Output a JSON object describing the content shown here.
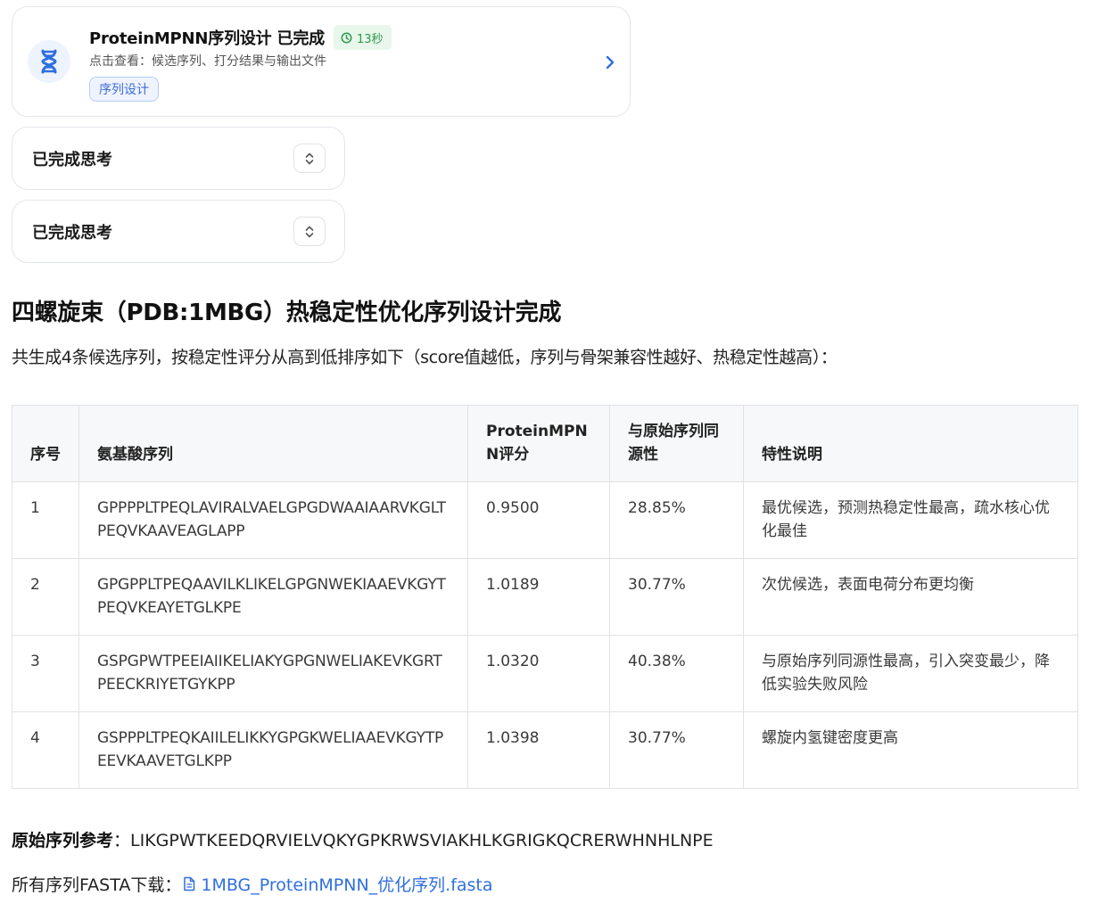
{
  "task_card": {
    "title": "ProteinMPNN序列设计 已完成",
    "time": "13秒",
    "subtitle": "点击查看：候选序列、打分结果与输出文件",
    "tag": "序列设计"
  },
  "thinking": [
    {
      "label": "已完成思考"
    },
    {
      "label": "已完成思考"
    }
  ],
  "heading": "四螺旋束（PDB:1MBG）热稳定性优化序列设计完成",
  "intro": "共生成4条候选序列，按稳定性评分从高到低排序如下（score值越低，序列与骨架兼容性越好、热稳定性越高）：",
  "table": {
    "headers": [
      "序号",
      "氨基酸序列",
      "ProteinMPNN评分",
      "与原始序列同源性",
      "特性说明"
    ],
    "rows": [
      [
        "1",
        "GPPPPLTPEQLAVIRALVAELGPGDWAAIAARVKGLTPEQVKAAVEAGLAPP",
        "0.9500",
        "28.85%",
        "最优候选，预测热稳定性最高，疏水核心优化最佳"
      ],
      [
        "2",
        "GPGPPLTPEQAAVILKLIKELGPGNWEKIAAEVKGYTPEQVKEAYETGLKPE",
        "1.0189",
        "30.77%",
        "次优候选，表面电荷分布更均衡"
      ],
      [
        "3",
        "GSPGPWTPEEIAIIKELIAKYGPGNWELIAKEVKGRTPEECKRIYETGYKPP",
        "1.0320",
        "40.38%",
        "与原始序列同源性最高，引入突变最少，降低实验失败风险"
      ],
      [
        "4",
        "GSPPPLTPEQKAIILELIKKYGPGKWELIAAEVKGYTPEEVKAAVETGLKPP",
        "1.0398",
        "30.77%",
        "螺旋内氢键密度更高"
      ]
    ]
  },
  "reference": {
    "label": "原始序列参考",
    "separator": "：",
    "sequence": "LIKGPWTKEEDQRVIELVQKYGPKRWSVIAKHLKGRIGKQCRERWHNHLNPE"
  },
  "download": {
    "label": "所有序列FASTA下载：",
    "file": "1MBG_ProteinMPNN_优化序列.fasta"
  },
  "icons": {
    "task": "dna-icon",
    "time": "clock-icon",
    "open": "chevron-right-icon",
    "toggle": "expand-collapse-icon",
    "file": "file-icon"
  },
  "colors": {
    "accent": "#2f6fe0",
    "badge_green": "#2f9a4b",
    "tag_blue": "#3d6bd6"
  }
}
